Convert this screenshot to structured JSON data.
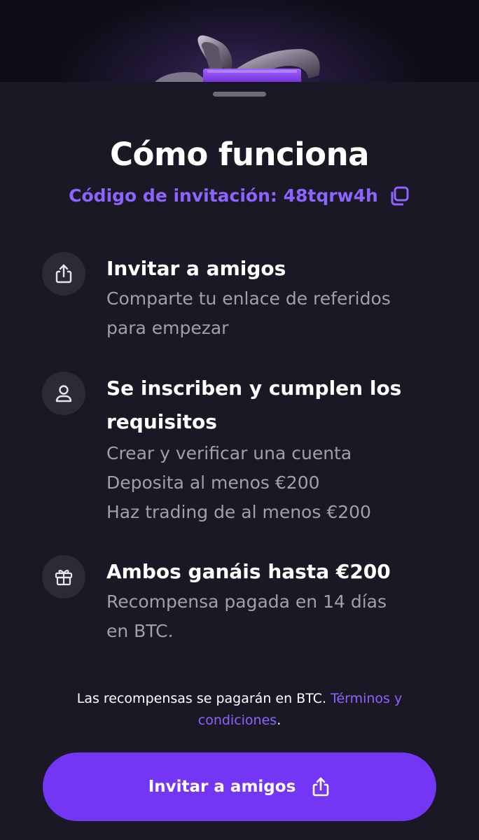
{
  "header": {
    "illustration_icon": "gift-ribbon-icon"
  },
  "sheet": {
    "title": "Cómo funciona",
    "invite_code_label": "Código de invitación: 48tqrw4h",
    "copy_icon": "copy-icon"
  },
  "steps": [
    {
      "icon": "share-icon",
      "title": "Invitar a amigos",
      "desc_lines": [
        "Comparte tu enlace de referidos",
        "para empezar"
      ]
    },
    {
      "icon": "user-icon",
      "title_lines": [
        "Se inscriben y cumplen los",
        "requisitos"
      ],
      "desc_lines": [
        "Crear y verificar una cuenta",
        "Deposita al menos €200",
        "Haz trading de al menos €200"
      ]
    },
    {
      "icon": "gift-icon",
      "title": "Ambos ganáis hasta €200",
      "desc_lines": [
        "Recompensa pagada en 14 días",
        "en BTC."
      ]
    }
  ],
  "footer": {
    "text": "Las recompensas se pagarán en BTC. ",
    "link_line1": "Términos y",
    "link_line2": "condiciones",
    "end": "."
  },
  "cta": {
    "label": "Invitar a amigos",
    "icon": "share-icon"
  },
  "colors": {
    "background": "#1a1824",
    "accent": "#8d64ff",
    "button": "#7336f5",
    "muted_text": "#a19fab",
    "icon_circle": "#2c2a36"
  }
}
